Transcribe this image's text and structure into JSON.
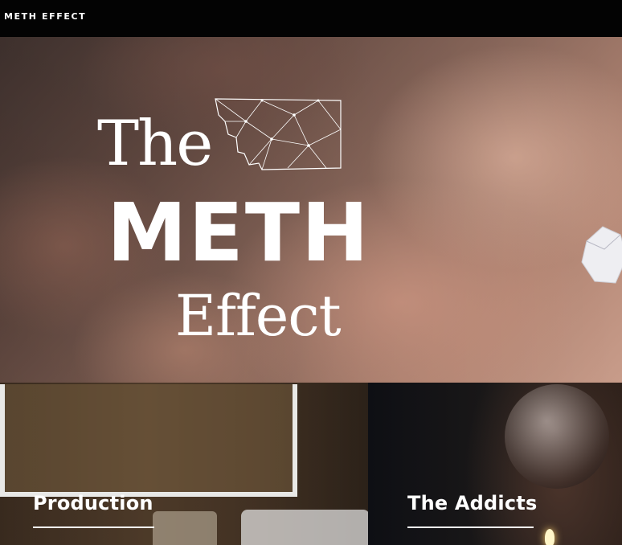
{
  "nav": {
    "brand": "METH EFFECT"
  },
  "hero": {
    "title_the": "The",
    "title_meth": "METH",
    "title_effect": "Effect"
  },
  "sections": [
    {
      "label": "Production"
    },
    {
      "label": "The Addicts"
    }
  ],
  "colors": {
    "background": "#000000",
    "text": "#ffffff"
  }
}
